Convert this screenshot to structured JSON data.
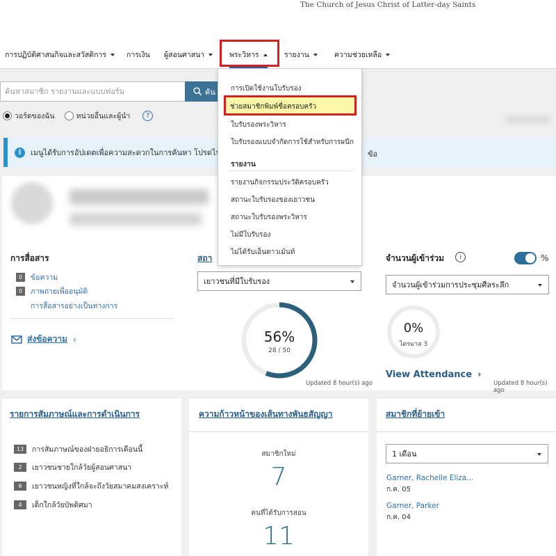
{
  "header": {
    "org_name": "The Church of Jesus Christ of Latter-day Saints"
  },
  "nav": {
    "items": [
      {
        "label": "การปฏิบัติศาสนกิจและสวัสดิการ"
      },
      {
        "label": "การเงิน"
      },
      {
        "label": "ผู้สอนศาสนา"
      },
      {
        "label": "พระวิหาร"
      },
      {
        "label": "รายงาน"
      },
      {
        "label": "ความช่วยเหลือ"
      }
    ]
  },
  "search": {
    "placeholder": "ค้นหาสมาชิก รายงานและแบบฟอร์ม",
    "button_label": "ค้น"
  },
  "scope": {
    "option1": "วอร์ดของฉัน",
    "option2": "หน่วยอื่นและผู้นำ",
    "help": "?"
  },
  "banner": {
    "text": "เมนูได้รับการอัปเดตเพื่อความสะดวกในการค้นหา โปรดไป",
    "tail": "ข้อ"
  },
  "menu": {
    "items": [
      "การเปิดใช้งานใบรับรอง",
      "ช่วยสมาชิกพิมพ์ชื่อครอบครัว",
      "ใบรับรองพระวิหาร",
      "ใบรับรองแบบจำกัดการใช้สำหรับการผนึก"
    ],
    "section_header": "รายงาน",
    "report_items": [
      "รายงานกิจกรรมประวัติครอบครัว",
      "สถานะใบรับรองของเยาวชน",
      "สถานะใบรับรองพระวิหาร",
      "ไม่มีใบรับรอง",
      "ไม่ได้รับเอ็นดาวเม้นท์"
    ]
  },
  "communications": {
    "title": "การสื่อสาร",
    "items": [
      {
        "count": "0",
        "label": "ข้อความ"
      },
      {
        "count": "0",
        "label": "ภาพถ่ายเพื่ออนุมัติ"
      },
      {
        "count": "",
        "label": "การสื่อสารอย่างเป็นทางการ"
      }
    ],
    "send_link": "ส่งข้อความ"
  },
  "status": {
    "title_partial": "สถา",
    "select_value": "เยาวชนที่มีใบรับรอง",
    "percent": "56%",
    "fraction": "28 / 50",
    "progress": 0.56,
    "updated": "Updated 8 hour(s) ago"
  },
  "attendance": {
    "title": "จำนวนผู้เข้าร่วม",
    "toggle_label": "%",
    "select_value": "จำนวนผู้เข้าร่วมการประชุมศีลระลึก",
    "percent": "0%",
    "sublabel": "ไตรมาส 3",
    "view_link": "View Attendance",
    "updated": "Updated 8 hour(s) ago"
  },
  "interviews": {
    "title": "รายการสัมภาษณ์และการดำเนินการ",
    "items": [
      {
        "count": "13",
        "label": "การสัมภาษณ์ของฝ่ายอธิการเดือนนี้"
      },
      {
        "count": "2",
        "label": "เยาวชนชายใกล้วัยผู้สอนศาสนา"
      },
      {
        "count": "6",
        "label": "เยาวชนหญิงที่ใกล้จะถึงวัยสมาคมสงเคราะห์"
      },
      {
        "count": "4",
        "label": "เด็กใกล้วัยบัพติศมา"
      }
    ]
  },
  "covenant": {
    "title": "ความก้าวหน้าของเส้นทางพันธสัญญา",
    "new_members_label": "สมาชิกใหม่",
    "new_members_value": "7",
    "taught_label": "คนที่ได้รับการสอน",
    "taught_value": "11"
  },
  "moved_in": {
    "title": "สมาชิกที่ย้ายเข้า",
    "select_value": "1 เดือน",
    "members": [
      {
        "name": "Garner, Rachelle Eliza...",
        "date": "ก.ค. 05"
      },
      {
        "name": "Garner, Parker",
        "date": "ก.ค. 04"
      }
    ]
  }
}
